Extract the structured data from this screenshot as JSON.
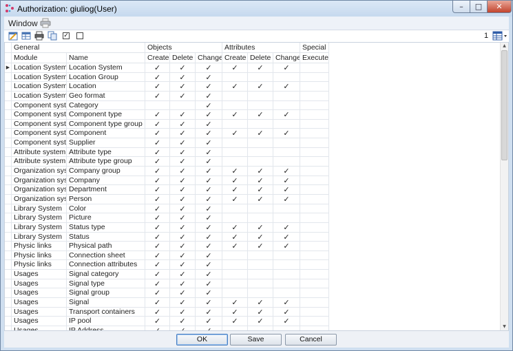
{
  "window": {
    "title": "Authorization: giuliog(User)",
    "controls": {
      "minimize": "–",
      "maximize": "□",
      "close": "✕"
    }
  },
  "menubar": {
    "window_label": "Window",
    "print_icon": "printer-icon"
  },
  "toolbar": {
    "icons": [
      "edit-rows-icon",
      "table-icon",
      "print-icon",
      "copy-icon"
    ],
    "check_all": "✓",
    "uncheck_all": "",
    "page_number": "1",
    "layout_icon": "table-layout-icon"
  },
  "grid": {
    "groups": {
      "general": "General",
      "objects": "Objects",
      "attributes": "Attributes",
      "special": "Special"
    },
    "columns": {
      "module": "Module",
      "name": "Name",
      "obj_create": "Create",
      "obj_delete": "Delete",
      "obj_change": "Change",
      "att_create": "Create",
      "att_delete": "Delete",
      "att_change": "Change",
      "special_execute": "Execute"
    },
    "check_glyph": "✓",
    "current_row_marker": "▶",
    "rows": [
      {
        "module": "Location System",
        "name": "Location System",
        "oc": 1,
        "od": 1,
        "och": 1,
        "ac": 1,
        "ad": 1,
        "ach": 1,
        "se": 0
      },
      {
        "module": "Location System",
        "name": "Location Group",
        "oc": 1,
        "od": 1,
        "och": 1,
        "ac": 0,
        "ad": 0,
        "ach": 0,
        "se": 0
      },
      {
        "module": "Location System",
        "name": "Location",
        "oc": 1,
        "od": 1,
        "och": 1,
        "ac": 1,
        "ad": 1,
        "ach": 1,
        "se": 0
      },
      {
        "module": "Location System",
        "name": "Geo format",
        "oc": 1,
        "od": 1,
        "och": 1,
        "ac": 0,
        "ad": 0,
        "ach": 0,
        "se": 0
      },
      {
        "module": "Component system",
        "name": "Category",
        "oc": 0,
        "od": 0,
        "och": 1,
        "ac": 0,
        "ad": 0,
        "ach": 0,
        "se": 0
      },
      {
        "module": "Component system",
        "name": "Component type",
        "oc": 1,
        "od": 1,
        "och": 1,
        "ac": 1,
        "ad": 1,
        "ach": 1,
        "se": 0
      },
      {
        "module": "Component system",
        "name": "Component type group",
        "oc": 1,
        "od": 1,
        "och": 1,
        "ac": 0,
        "ad": 0,
        "ach": 0,
        "se": 0
      },
      {
        "module": "Component system",
        "name": "Component",
        "oc": 1,
        "od": 1,
        "och": 1,
        "ac": 1,
        "ad": 1,
        "ach": 1,
        "se": 0
      },
      {
        "module": "Component system",
        "name": "Supplier",
        "oc": 1,
        "od": 1,
        "och": 1,
        "ac": 0,
        "ad": 0,
        "ach": 0,
        "se": 0
      },
      {
        "module": "Attribute system",
        "name": "Attribute type",
        "oc": 1,
        "od": 1,
        "och": 1,
        "ac": 0,
        "ad": 0,
        "ach": 0,
        "se": 0
      },
      {
        "module": "Attribute system",
        "name": "Attribute type group",
        "oc": 1,
        "od": 1,
        "och": 1,
        "ac": 0,
        "ad": 0,
        "ach": 0,
        "se": 0
      },
      {
        "module": "Organization system",
        "name": "Company group",
        "oc": 1,
        "od": 1,
        "och": 1,
        "ac": 1,
        "ad": 1,
        "ach": 1,
        "se": 0
      },
      {
        "module": "Organization system",
        "name": "Company",
        "oc": 1,
        "od": 1,
        "och": 1,
        "ac": 1,
        "ad": 1,
        "ach": 1,
        "se": 0
      },
      {
        "module": "Organization system",
        "name": "Department",
        "oc": 1,
        "od": 1,
        "och": 1,
        "ac": 1,
        "ad": 1,
        "ach": 1,
        "se": 0
      },
      {
        "module": "Organization system",
        "name": "Person",
        "oc": 1,
        "od": 1,
        "och": 1,
        "ac": 1,
        "ad": 1,
        "ach": 1,
        "se": 0
      },
      {
        "module": "Library System",
        "name": "Color",
        "oc": 1,
        "od": 1,
        "och": 1,
        "ac": 0,
        "ad": 0,
        "ach": 0,
        "se": 0
      },
      {
        "module": "Library System",
        "name": "Picture",
        "oc": 1,
        "od": 1,
        "och": 1,
        "ac": 0,
        "ad": 0,
        "ach": 0,
        "se": 0
      },
      {
        "module": "Library System",
        "name": "Status type",
        "oc": 1,
        "od": 1,
        "och": 1,
        "ac": 1,
        "ad": 1,
        "ach": 1,
        "se": 0
      },
      {
        "module": "Library System",
        "name": "Status",
        "oc": 1,
        "od": 1,
        "och": 1,
        "ac": 1,
        "ad": 1,
        "ach": 1,
        "se": 0
      },
      {
        "module": "Physic links",
        "name": "Physical path",
        "oc": 1,
        "od": 1,
        "och": 1,
        "ac": 1,
        "ad": 1,
        "ach": 1,
        "se": 0
      },
      {
        "module": "Physic links",
        "name": "Connection sheet",
        "oc": 1,
        "od": 1,
        "och": 1,
        "ac": 0,
        "ad": 0,
        "ach": 0,
        "se": 0
      },
      {
        "module": "Physic links",
        "name": "Connection attributes",
        "oc": 1,
        "od": 1,
        "och": 1,
        "ac": 0,
        "ad": 0,
        "ach": 0,
        "se": 0
      },
      {
        "module": "Usages",
        "name": "Signal category",
        "oc": 1,
        "od": 1,
        "och": 1,
        "ac": 0,
        "ad": 0,
        "ach": 0,
        "se": 0
      },
      {
        "module": "Usages",
        "name": "Signal type",
        "oc": 1,
        "od": 1,
        "och": 1,
        "ac": 0,
        "ad": 0,
        "ach": 0,
        "se": 0
      },
      {
        "module": "Usages",
        "name": "Signal group",
        "oc": 1,
        "od": 1,
        "och": 1,
        "ac": 0,
        "ad": 0,
        "ach": 0,
        "se": 0
      },
      {
        "module": "Usages",
        "name": "Signal",
        "oc": 1,
        "od": 1,
        "och": 1,
        "ac": 1,
        "ad": 1,
        "ach": 1,
        "se": 0
      },
      {
        "module": "Usages",
        "name": "Transport containers",
        "oc": 1,
        "od": 1,
        "och": 1,
        "ac": 1,
        "ad": 1,
        "ach": 1,
        "se": 0
      },
      {
        "module": "Usages",
        "name": "IP pool",
        "oc": 1,
        "od": 1,
        "och": 1,
        "ac": 1,
        "ad": 1,
        "ach": 1,
        "se": 0
      },
      {
        "module": "Usages",
        "name": "IP Address",
        "oc": 1,
        "od": 1,
        "och": 1,
        "ac": 0,
        "ad": 0,
        "ach": 0,
        "se": 0
      }
    ]
  },
  "footer": {
    "ok": "OK",
    "save": "Save",
    "cancel": "Cancel"
  },
  "colors": {
    "titlebar": "#c6d9ee",
    "frame": "#cfdff0",
    "close": "#c2442d",
    "ok_border": "#4a7fc1"
  }
}
